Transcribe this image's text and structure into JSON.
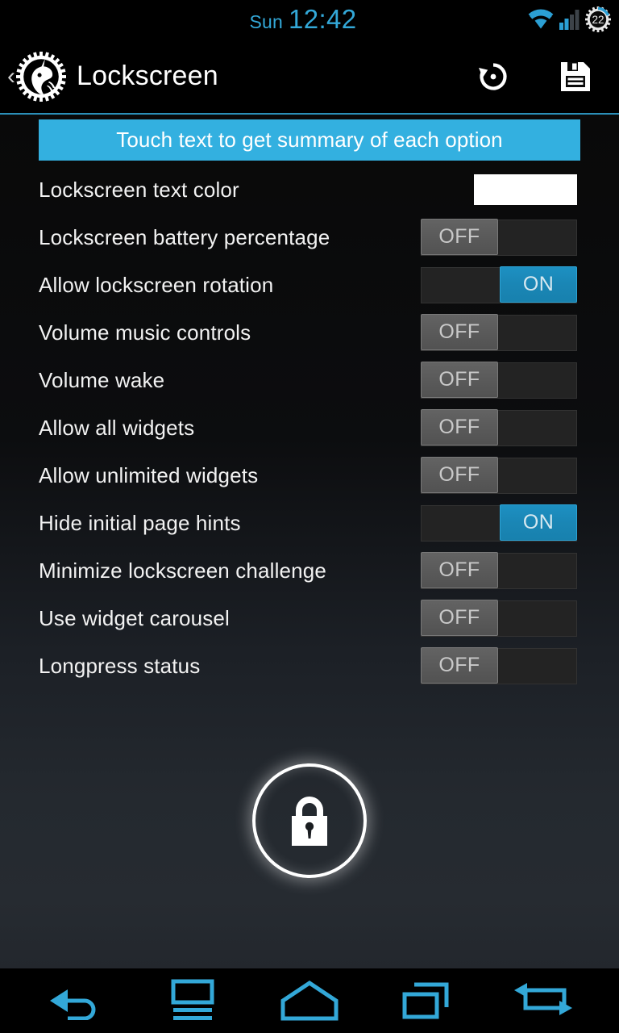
{
  "status_bar": {
    "day": "Sun",
    "time": "12:42",
    "battery_level": "22",
    "icons": [
      "wifi-icon",
      "cellular-signal-icon",
      "battery-gear-icon"
    ],
    "accent_color": "#33a8d8"
  },
  "action_bar": {
    "back_chevron": "‹",
    "logo": "unicorn-gear-logo",
    "title": "Lockscreen",
    "restore_icon": "restore-defaults-icon",
    "save_icon": "save-floppy-icon"
  },
  "hint_banner": {
    "text": "Touch text to get summary of each option",
    "background_color": "#33b0e0"
  },
  "settings": {
    "rows": [
      {
        "label": "Lockscreen text color",
        "control": "color",
        "value": "#ffffff"
      },
      {
        "label": "Lockscreen battery percentage",
        "control": "toggle",
        "state": "off",
        "state_label": "OFF"
      },
      {
        "label": "Allow lockscreen rotation",
        "control": "toggle",
        "state": "on",
        "state_label": "ON"
      },
      {
        "label": "Volume music controls",
        "control": "toggle",
        "state": "off",
        "state_label": "OFF"
      },
      {
        "label": "Volume wake",
        "control": "toggle",
        "state": "off",
        "state_label": "OFF"
      },
      {
        "label": "Allow all widgets",
        "control": "toggle",
        "state": "off",
        "state_label": "OFF"
      },
      {
        "label": "Allow unlimited widgets",
        "control": "toggle",
        "state": "off",
        "state_label": "OFF"
      },
      {
        "label": "Hide initial page hints",
        "control": "toggle",
        "state": "on",
        "state_label": "ON"
      },
      {
        "label": "Minimize lockscreen challenge",
        "control": "toggle",
        "state": "off",
        "state_label": "OFF"
      },
      {
        "label": "Use widget carousel",
        "control": "toggle",
        "state": "off",
        "state_label": "OFF"
      },
      {
        "label": "Longpress status",
        "control": "toggle",
        "state": "off",
        "state_label": "OFF"
      }
    ]
  },
  "lock_badge": {
    "icon": "padlock-icon"
  },
  "nav_bar": {
    "buttons": [
      {
        "icon": "back-arrow-icon"
      },
      {
        "icon": "menu-icon"
      },
      {
        "icon": "home-icon"
      },
      {
        "icon": "recents-icon"
      },
      {
        "icon": "switch-apps-icon"
      }
    ],
    "accent_color": "#33a8d8"
  }
}
